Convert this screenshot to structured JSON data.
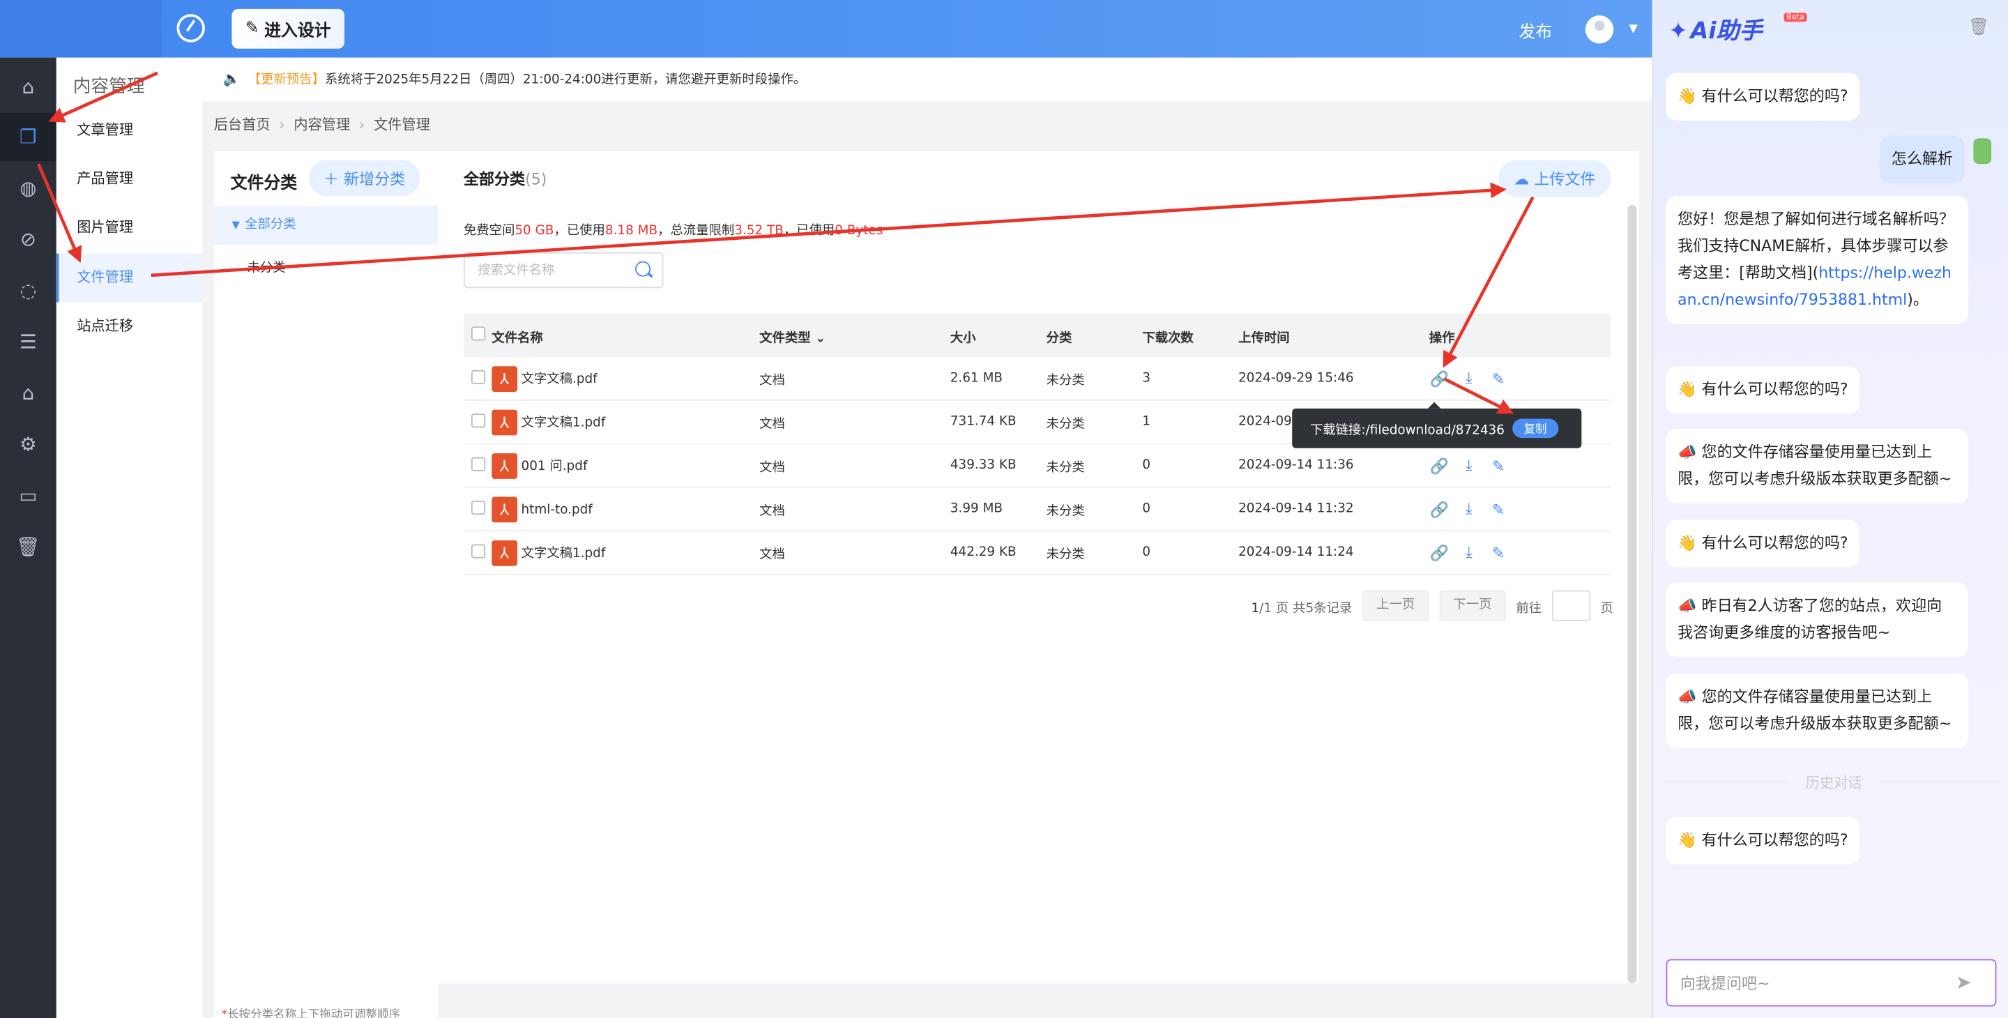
{
  "topbar": {
    "design_label": "进入设计",
    "publish_label": "发布"
  },
  "submenu": {
    "title": "内容管理",
    "items": [
      "文章管理",
      "产品管理",
      "图片管理",
      "文件管理",
      "站点迁移"
    ],
    "active_index": 3
  },
  "notice": {
    "tag": "【更新预告】",
    "text": "系统将于2025年5月22日（周四）21:00-24:00进行更新，请您避开更新时段操作。"
  },
  "breadcrumb": [
    "后台首页",
    "内容管理",
    "文件管理"
  ],
  "categories": {
    "title": "文件分类",
    "add_label": "新增分类",
    "all_label": "全部分类",
    "uncategorized": "未分类",
    "tip_star": "*",
    "tip": "长按分类名称上下拖动可调整顺序"
  },
  "main": {
    "title": "全部分类",
    "count": "(5)",
    "upload_label": "上传文件",
    "space": {
      "free_label": "免费空间",
      "free_value": "50 GB",
      "used_label": "，已使用",
      "used_value": "8.18 MB",
      "traffic_label": "，总流量限制",
      "traffic_value": "3.52 TB",
      "traffic_used_label": "，已使用",
      "traffic_used_value": "0 Bytes"
    },
    "search_placeholder": "搜索文件名称",
    "columns": [
      "文件名称",
      "文件类型",
      "大小",
      "分类",
      "下载次数",
      "上传时间",
      "操作"
    ],
    "rows": [
      {
        "name": "文字文稿.pdf",
        "type": "文档",
        "size": "2.61 MB",
        "category": "未分类",
        "downloads": "3",
        "uploaded": "2024-09-29 15:46"
      },
      {
        "name": "文字文稿1.pdf",
        "type": "文档",
        "size": "731.74 KB",
        "category": "未分类",
        "downloads": "1",
        "uploaded": "2024-09-29 15:46"
      },
      {
        "name": "001 问.pdf",
        "type": "文档",
        "size": "439.33 KB",
        "category": "未分类",
        "downloads": "0",
        "uploaded": "2024-09-14 11:36"
      },
      {
        "name": "html-to.pdf",
        "type": "文档",
        "size": "3.99 MB",
        "category": "未分类",
        "downloads": "0",
        "uploaded": "2024-09-14 11:32"
      },
      {
        "name": "文字文稿1.pdf",
        "type": "文档",
        "size": "442.29 KB",
        "category": "未分类",
        "downloads": "0",
        "uploaded": "2024-09-14 11:24"
      }
    ],
    "pager": {
      "current": "1",
      "info": "/1 页 共5条记录",
      "prev": "上一页",
      "next": "下一页",
      "goto": "前往",
      "page_unit": "页"
    },
    "tooltip": {
      "text": "下载链接:/filedownload/872436",
      "copy_label": "复制"
    }
  },
  "ai": {
    "logo": "Ai助手",
    "beta": "Beta",
    "messages": [
      {
        "role": "bot",
        "text": "👋 有什么可以帮您的吗?"
      },
      {
        "role": "user",
        "text": "怎么解析"
      },
      {
        "role": "bot",
        "text": "您好！您是想了解如何进行域名解析吗？我们支持CNAME解析，具体步骤可以参考这里：[帮助文档](",
        "link": "https://help.wezhan.cn/newsinfo/7953881.html",
        "tail": ")。"
      },
      {
        "role": "bot",
        "text": "👋 有什么可以帮您的吗?"
      },
      {
        "role": "bot",
        "text": "📣 您的文件存储容量使用量已达到上限，您可以考虑升级版本获取更多配额~"
      },
      {
        "role": "bot",
        "text": "👋 有什么可以帮您的吗?"
      },
      {
        "role": "bot",
        "text": "📣 昨日有2人访客了您的站点，欢迎向我咨询更多维度的访客报告吧~"
      },
      {
        "role": "bot",
        "text": "📣 您的文件存储容量使用量已达到上限，您可以考虑升级版本获取更多配额~"
      },
      {
        "role": "bot",
        "text": "👋 有什么可以帮您的吗?"
      }
    ],
    "history_label": "历史对话",
    "input_placeholder": "向我提问吧~"
  },
  "colors": {
    "accent": "#4a8ef3",
    "annotation_arrow": "#e8332a",
    "pdf_icon": "#e5532b"
  }
}
